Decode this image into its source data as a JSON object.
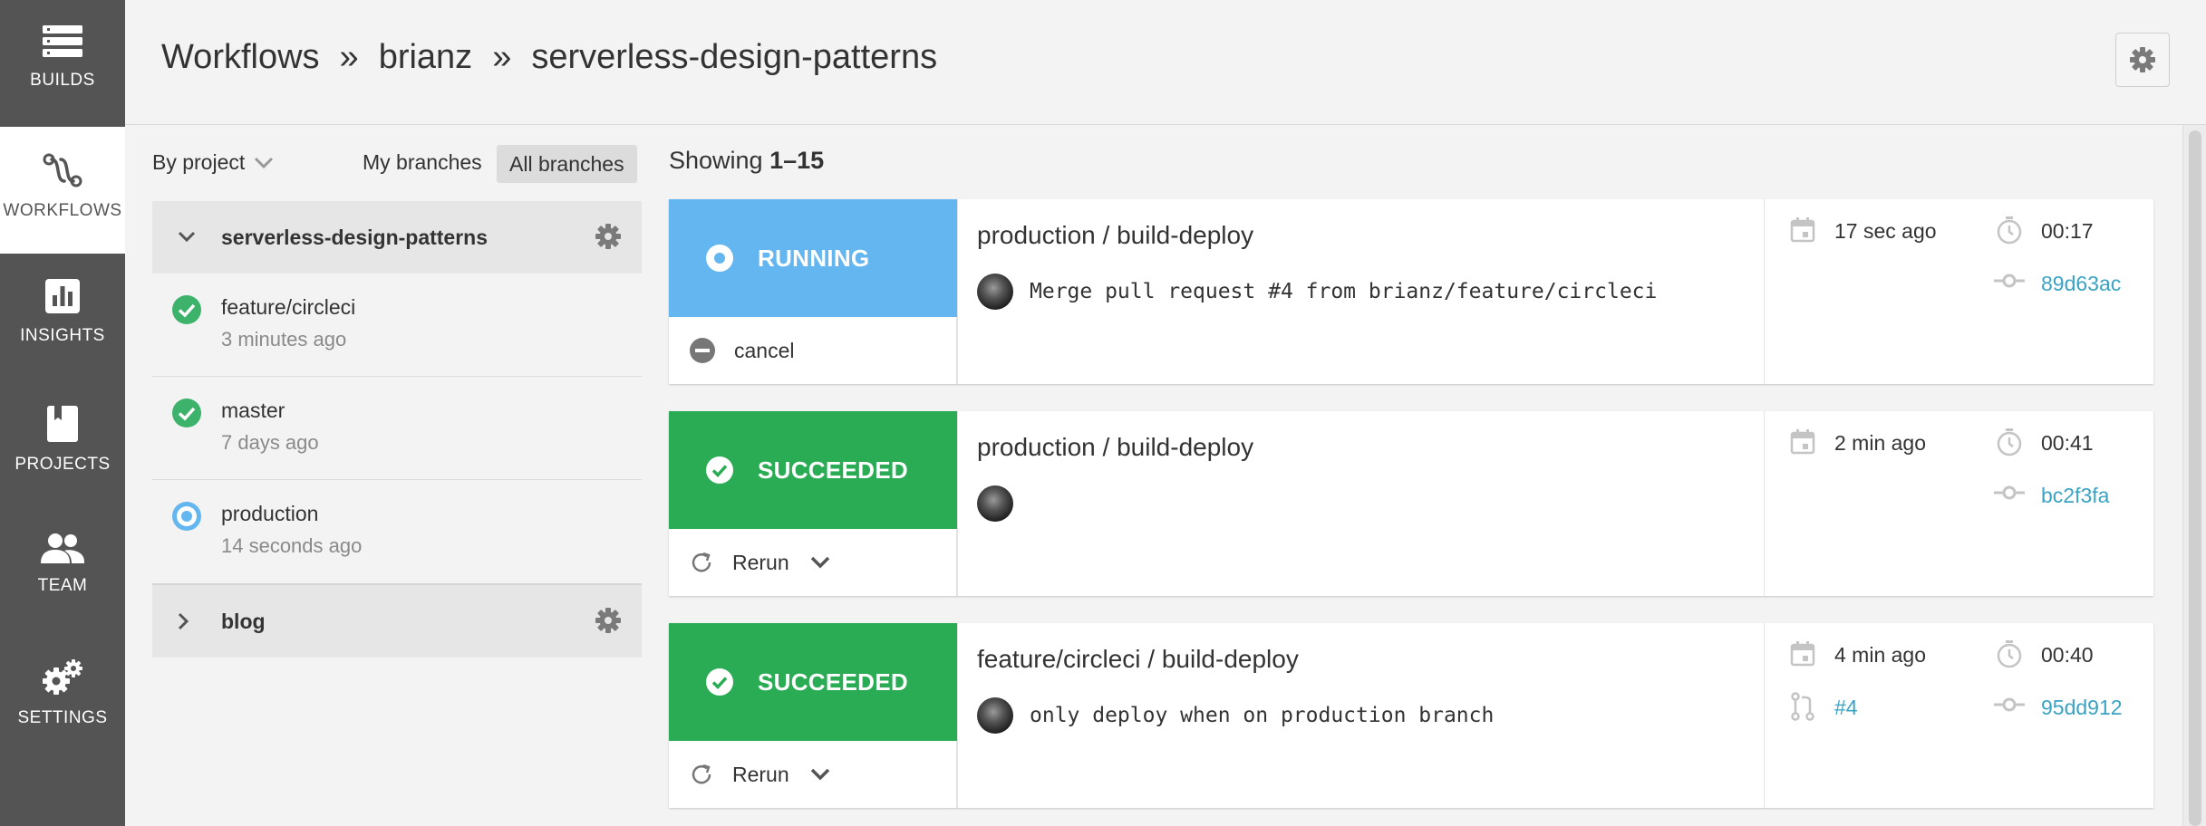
{
  "nav": {
    "items": [
      {
        "label": "BUILDS",
        "icon": "builds-icon"
      },
      {
        "label": "WORKFLOWS",
        "icon": "workflows-icon"
      },
      {
        "label": "INSIGHTS",
        "icon": "insights-icon"
      },
      {
        "label": "PROJECTS",
        "icon": "projects-icon"
      },
      {
        "label": "TEAM",
        "icon": "team-icon"
      },
      {
        "label": "SETTINGS",
        "icon": "settings-icon"
      }
    ]
  },
  "header": {
    "crumbs": [
      "Workflows",
      "brianz",
      "serverless-design-patterns"
    ],
    "separator": "»"
  },
  "sidebar": {
    "filter_label": "By project",
    "my_branches": "My branches",
    "all_branches": "All branches",
    "projects": [
      {
        "name": "serverless-design-patterns",
        "expanded": true,
        "branches": [
          {
            "name": "feature/circleci",
            "time": "3 minutes ago",
            "status": "success"
          },
          {
            "name": "master",
            "time": "7 days ago",
            "status": "success"
          },
          {
            "name": "production",
            "time": "14 seconds ago",
            "status": "running"
          }
        ]
      },
      {
        "name": "blog",
        "expanded": false
      }
    ]
  },
  "main": {
    "showing_prefix": "Showing",
    "showing_range": "1–15",
    "workflows": [
      {
        "status": "RUNNING",
        "status_kind": "running",
        "action": "cancel",
        "title": "production / build-deploy",
        "commit_message": "Merge pull request #4 from brianz/feature/circleci",
        "started": "17 sec ago",
        "duration": "00:17",
        "commit_hash": "89d63ac",
        "pr": ""
      },
      {
        "status": "SUCCEEDED",
        "status_kind": "success",
        "action": "Rerun",
        "title": "production / build-deploy",
        "commit_message": "",
        "started": "2 min ago",
        "duration": "00:41",
        "commit_hash": "bc2f3fa",
        "pr": ""
      },
      {
        "status": "SUCCEEDED",
        "status_kind": "success",
        "action": "Rerun",
        "title": "feature/circleci / build-deploy",
        "commit_message": "only deploy when on production branch",
        "started": "4 min ago",
        "duration": "00:40",
        "commit_hash": "95dd912",
        "pr": "#4"
      }
    ]
  },
  "colors": {
    "nav_bg": "#545454",
    "running": "#63b6ef",
    "success": "#2aac55",
    "link": "#3aa3c4"
  }
}
